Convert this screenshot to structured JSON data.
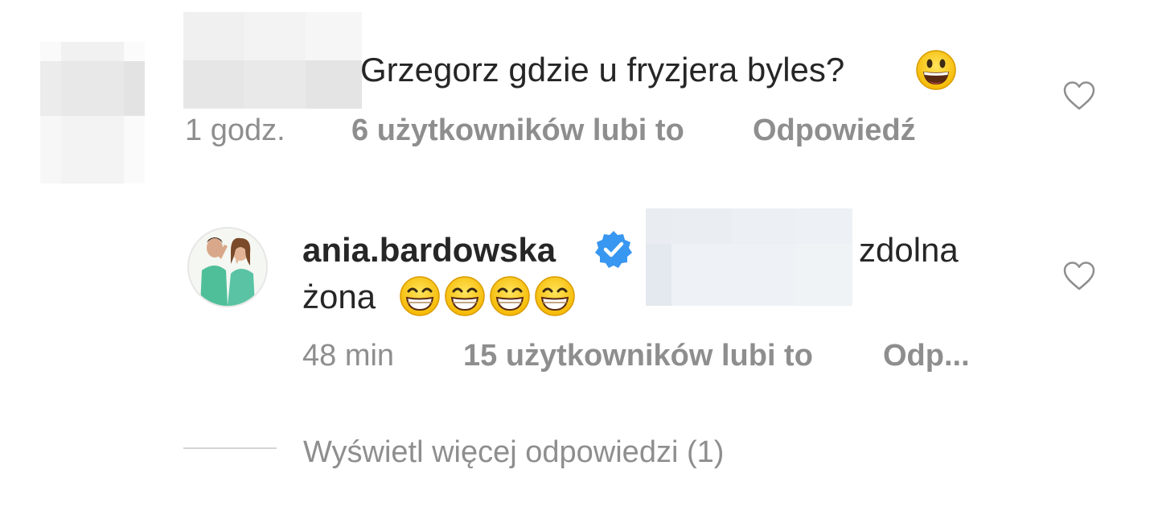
{
  "comment": {
    "text": "Grzegorz gdzie u fryzjera byles?",
    "time": "1 godz.",
    "likes": "6 użytkowników lubi to",
    "reply": "Odpowiedź",
    "emoji": "grinning-face"
  },
  "reply": {
    "username": "ania.bardowska",
    "text_end": "zdolna",
    "text_line2": "żona",
    "time": "48 min",
    "likes": "15 użytkowników lubi to",
    "reply": "Odp...",
    "emoji": "beaming-face-with-smiling-eyes"
  },
  "view_more": "Wyświetl więcej odpowiedzi (1)",
  "colors": {
    "text": "#262626",
    "meta": "#8e8e8e",
    "verified": "#3897f0",
    "emoji_yellow": "#ffcc33"
  }
}
